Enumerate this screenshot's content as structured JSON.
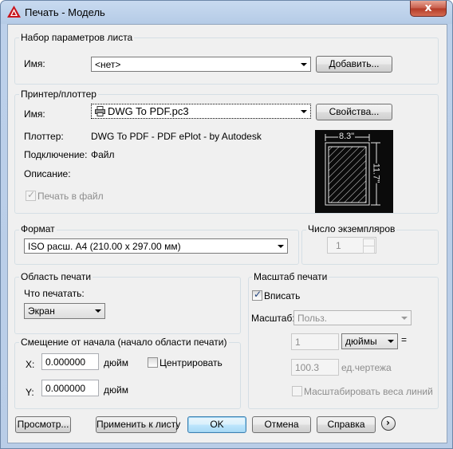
{
  "window": {
    "title": "Печать - Модель",
    "close_label": "x"
  },
  "page_setup": {
    "group_title": "Набор параметров листа",
    "name_label": "Имя:",
    "name_value": "<нет>",
    "add_button": "Добавить..."
  },
  "printer": {
    "group_title": "Принтер/плоттер",
    "name_label": "Имя:",
    "name_value": "DWG To PDF.pc3",
    "properties_button": "Свойства...",
    "plotter_label": "Плоттер:",
    "plotter_value": "DWG To PDF - PDF ePlot - by Autodesk",
    "connection_label": "Подключение:",
    "connection_value": "Файл",
    "description_label": "Описание:",
    "print_to_file_label": "Печать в файл",
    "print_to_file_checked": true,
    "preview_width": "8.3\"",
    "preview_height": "11.7\""
  },
  "format": {
    "group_title": "Формат",
    "value": "ISO расш. A4 (210.00 x 297.00 мм)"
  },
  "copies": {
    "group_title": "Число экземпляров",
    "value": "1"
  },
  "print_area": {
    "group_title": "Область печати",
    "what_label": "Что печатать:",
    "what_value": "Экран"
  },
  "offset": {
    "group_title": "Смещение от начала (начало области печати)",
    "x_label": "X:",
    "x_value": "0.000000",
    "x_unit": "дюйм",
    "y_label": "Y:",
    "y_value": "0.000000",
    "y_unit": "дюйм",
    "center_label": "Центрировать",
    "center_checked": false
  },
  "scale": {
    "group_title": "Масштаб печати",
    "fit_label": "Вписать",
    "fit_checked": true,
    "scale_label": "Масштаб:",
    "scale_value": "Польз.",
    "value1": "1",
    "unit_value": "дюймы",
    "equals": "=",
    "value2": "100.3",
    "unit2_label": "ед.чертежа",
    "lineweights_label": "Масштабировать веса линий",
    "lineweights_checked": false
  },
  "buttons": {
    "preview": "Просмотр...",
    "apply": "Применить к листу",
    "ok": "OK",
    "cancel": "Отмена",
    "help": "Справка",
    "expand": "›"
  }
}
